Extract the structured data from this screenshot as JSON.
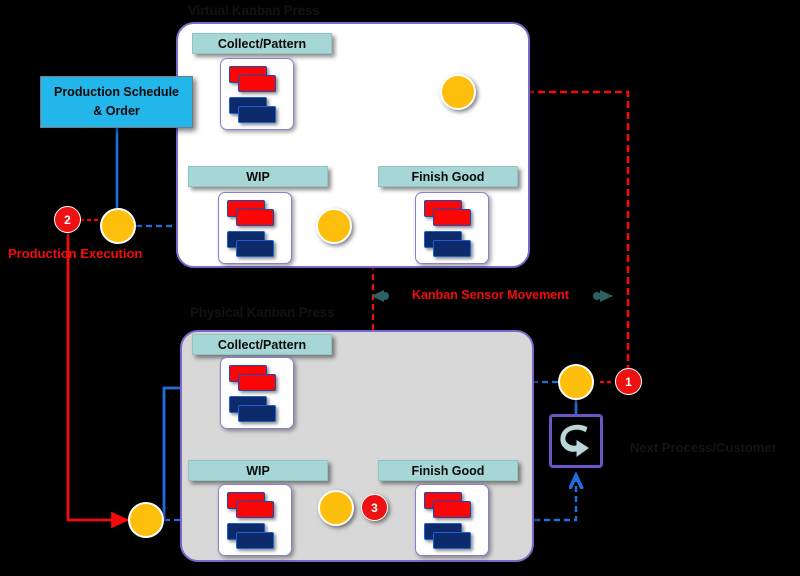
{
  "diagram": {
    "title_virtual": "Virtual Kanban Press",
    "title_physical": "Physical Kanban Press",
    "schedule_line1": "Production Schedule",
    "schedule_line2": "& Order",
    "label_production_execution": "Production Execution",
    "label_kanban_sensor_movement": "Kanban Sensor Movement",
    "label_next_process": "Next Process/Customer",
    "sections": {
      "collect_pattern": "Collect/Pattern",
      "wip": "WIP",
      "finish_good": "Finish Good"
    },
    "markers": {
      "one": "1",
      "two": "2",
      "three": "3"
    },
    "colors": {
      "kanban_card_red": "#fb0606",
      "kanban_card_navy": "#0d2a6b",
      "header_teal": "#a6d6d6",
      "schedule_cyan": "#22b6ea",
      "node_yellow": "#fdbe0c",
      "marker_red": "#ee1111",
      "flow_blue": "#1f6fe0",
      "flow_red": "#f40b0b",
      "container_purple": "#7b68c8",
      "physical_fill": "#d8d8d8",
      "virtual_fill": "#ffffff",
      "background": "#000000"
    },
    "icons": {
      "sensor": "cycle-arrow-icon",
      "arrow_left": "arrow-left-icon",
      "arrow_right": "arrow-right-icon"
    }
  }
}
